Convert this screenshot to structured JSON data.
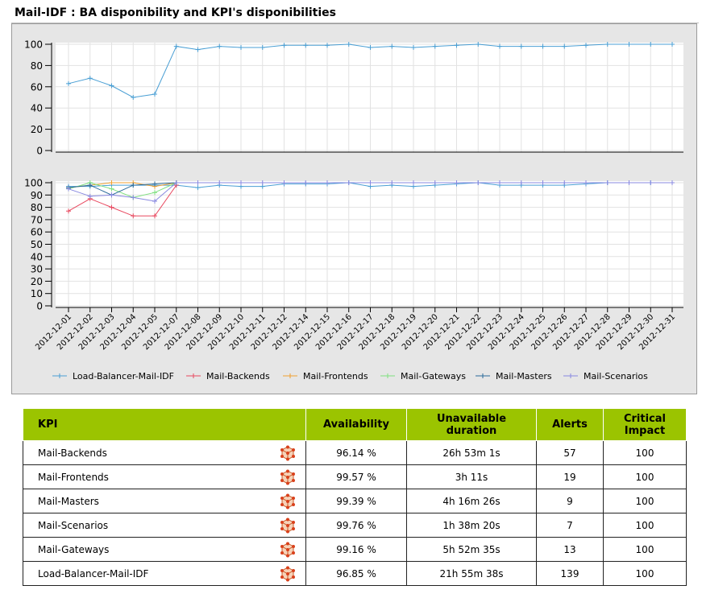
{
  "title": "Mail-IDF : BA disponibility and KPI's disponibilities",
  "chart_data": {
    "type": "line",
    "dates": [
      "2012-12-01",
      "2012-12-02",
      "2012-12-03",
      "2012-12-04",
      "2012-12-05",
      "2012-12-07",
      "2012-12-08",
      "2012-12-09",
      "2012-12-10",
      "2012-12-11",
      "2012-12-12",
      "2012-12-14",
      "2012-12-15",
      "2012-12-16",
      "2012-12-17",
      "2012-12-18",
      "2012-12-19",
      "2012-12-20",
      "2012-12-21",
      "2012-12-22",
      "2012-12-23",
      "2012-12-24",
      "2012-12-25",
      "2012-12-26",
      "2012-12-27",
      "2012-12-28",
      "2012-12-29",
      "2012-12-30",
      "2012-12-31"
    ],
    "panels": [
      {
        "ylim": [
          0,
          100
        ],
        "yticks": [
          0,
          20,
          40,
          60,
          80,
          100
        ],
        "series": [
          {
            "name": "Load-Balancer-Mail-IDF",
            "color": "#4a9fd4",
            "values": [
              63,
              68,
              61,
              50,
              53,
              98,
              95,
              98,
              97,
              97,
              99,
              99,
              99,
              100,
              97,
              98,
              97,
              98,
              99,
              100,
              98,
              98,
              98,
              98,
              99,
              100,
              100,
              100,
              100
            ]
          }
        ]
      },
      {
        "ylim": [
          0,
          100
        ],
        "yticks": [
          0,
          10,
          20,
          30,
          40,
          50,
          60,
          70,
          80,
          90,
          100
        ],
        "series": [
          {
            "name": "Load-Balancer-Mail-IDF",
            "color": "#4a9fd4",
            "values": [
              97,
              97,
              98,
              98,
              98,
              98,
              96,
              98,
              97,
              97,
              99,
              99,
              99,
              100,
              97,
              98,
              97,
              98,
              99,
              100,
              98,
              98,
              98,
              98,
              99,
              100,
              100,
              100,
              100
            ]
          },
          {
            "name": "Mail-Backends",
            "color": "#e8485f",
            "values": [
              77,
              87,
              80,
              73,
              73,
              98,
              null,
              null,
              null,
              null,
              null,
              null,
              null,
              null,
              null,
              null,
              null,
              null,
              null,
              null,
              null,
              null,
              null,
              null,
              null,
              null,
              null,
              null,
              null
            ]
          },
          {
            "name": "Mail-Frontends",
            "color": "#f0a030",
            "values": [
              96,
              98,
              100,
              100,
              97,
              100,
              null,
              null,
              null,
              null,
              null,
              null,
              null,
              null,
              null,
              null,
              null,
              null,
              null,
              null,
              null,
              null,
              null,
              null,
              null,
              null,
              null,
              null,
              null
            ]
          },
          {
            "name": "Mail-Gateways",
            "color": "#7fe07f",
            "values": [
              95,
              100,
              95,
              88,
              92,
              100,
              null,
              null,
              null,
              null,
              null,
              null,
              null,
              null,
              null,
              null,
              null,
              null,
              null,
              null,
              null,
              null,
              null,
              null,
              null,
              null,
              null,
              null,
              null
            ]
          },
          {
            "name": "Mail-Masters",
            "color": "#2a6a9a",
            "values": [
              96,
              98,
              90,
              98,
              99,
              100,
              null,
              null,
              null,
              null,
              null,
              null,
              null,
              null,
              null,
              null,
              null,
              null,
              null,
              null,
              null,
              null,
              null,
              null,
              null,
              null,
              null,
              null,
              null
            ]
          },
          {
            "name": "Mail-Scenarios",
            "color": "#8888e0",
            "values": [
              95,
              89,
              90,
              88,
              85,
              100,
              100,
              100,
              100,
              100,
              100,
              100,
              100,
              100,
              100,
              100,
              100,
              100,
              100,
              100,
              100,
              100,
              100,
              100,
              100,
              100,
              100,
              100,
              100
            ]
          }
        ]
      }
    ],
    "legend": [
      {
        "name": "Load-Balancer-Mail-IDF",
        "color": "#4a9fd4"
      },
      {
        "name": "Mail-Backends",
        "color": "#e8485f"
      },
      {
        "name": "Mail-Frontends",
        "color": "#f0a030"
      },
      {
        "name": "Mail-Gateways",
        "color": "#7fe07f"
      },
      {
        "name": "Mail-Masters",
        "color": "#2a6a9a"
      },
      {
        "name": "Mail-Scenarios",
        "color": "#8888e0"
      }
    ],
    "legend_position": "bottom"
  },
  "table": {
    "headers": {
      "kpi": "KPI",
      "availability": "Availability",
      "unavailable": "Unavailable duration",
      "alerts": "Alerts",
      "critical": "Critical Impact"
    },
    "rows": [
      {
        "name": "Mail-Backends",
        "availability": "96.14 %",
        "unavailable": "26h 53m 1s",
        "alerts": "57",
        "critical": "100"
      },
      {
        "name": "Mail-Frontends",
        "availability": "99.57 %",
        "unavailable": "3h 11s",
        "alerts": "19",
        "critical": "100"
      },
      {
        "name": "Mail-Masters",
        "availability": "99.39 %",
        "unavailable": "4h 16m 26s",
        "alerts": "9",
        "critical": "100"
      },
      {
        "name": "Mail-Scenarios",
        "availability": "99.76 %",
        "unavailable": "1h 38m 20s",
        "alerts": "7",
        "critical": "100"
      },
      {
        "name": "Mail-Gateways",
        "availability": "99.16 %",
        "unavailable": "5h 52m 35s",
        "alerts": "13",
        "critical": "100"
      },
      {
        "name": "Load-Balancer-Mail-IDF",
        "availability": "96.85 %",
        "unavailable": "21h 55m 38s",
        "alerts": "139",
        "critical": "100"
      }
    ],
    "row_icon": "ba-cube-icon"
  }
}
